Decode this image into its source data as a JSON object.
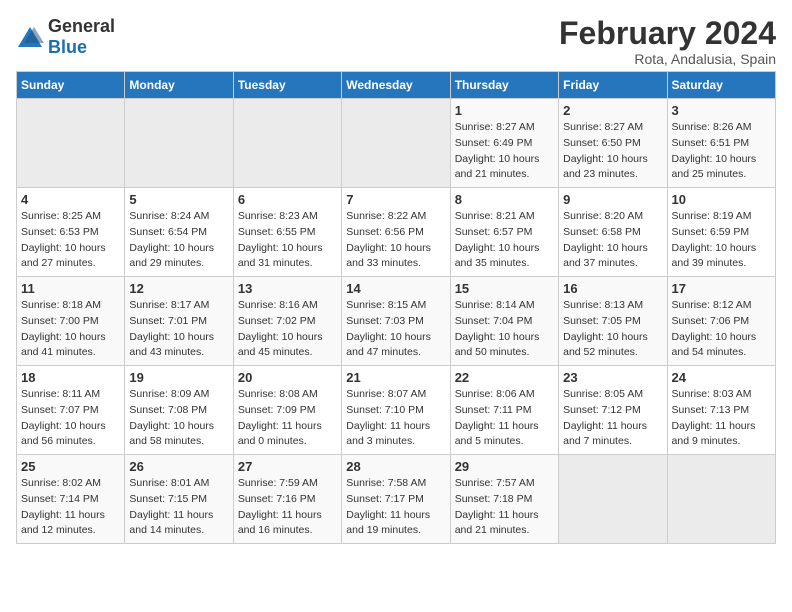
{
  "logo": {
    "general": "General",
    "blue": "Blue"
  },
  "title": "February 2024",
  "subtitle": "Rota, Andalusia, Spain",
  "days_of_week": [
    "Sunday",
    "Monday",
    "Tuesday",
    "Wednesday",
    "Thursday",
    "Friday",
    "Saturday"
  ],
  "weeks": [
    [
      {
        "day": "",
        "info": ""
      },
      {
        "day": "",
        "info": ""
      },
      {
        "day": "",
        "info": ""
      },
      {
        "day": "",
        "info": ""
      },
      {
        "day": "1",
        "info": "Sunrise: 8:27 AM\nSunset: 6:49 PM\nDaylight: 10 hours\nand 21 minutes."
      },
      {
        "day": "2",
        "info": "Sunrise: 8:27 AM\nSunset: 6:50 PM\nDaylight: 10 hours\nand 23 minutes."
      },
      {
        "day": "3",
        "info": "Sunrise: 8:26 AM\nSunset: 6:51 PM\nDaylight: 10 hours\nand 25 minutes."
      }
    ],
    [
      {
        "day": "4",
        "info": "Sunrise: 8:25 AM\nSunset: 6:53 PM\nDaylight: 10 hours\nand 27 minutes."
      },
      {
        "day": "5",
        "info": "Sunrise: 8:24 AM\nSunset: 6:54 PM\nDaylight: 10 hours\nand 29 minutes."
      },
      {
        "day": "6",
        "info": "Sunrise: 8:23 AM\nSunset: 6:55 PM\nDaylight: 10 hours\nand 31 minutes."
      },
      {
        "day": "7",
        "info": "Sunrise: 8:22 AM\nSunset: 6:56 PM\nDaylight: 10 hours\nand 33 minutes."
      },
      {
        "day": "8",
        "info": "Sunrise: 8:21 AM\nSunset: 6:57 PM\nDaylight: 10 hours\nand 35 minutes."
      },
      {
        "day": "9",
        "info": "Sunrise: 8:20 AM\nSunset: 6:58 PM\nDaylight: 10 hours\nand 37 minutes."
      },
      {
        "day": "10",
        "info": "Sunrise: 8:19 AM\nSunset: 6:59 PM\nDaylight: 10 hours\nand 39 minutes."
      }
    ],
    [
      {
        "day": "11",
        "info": "Sunrise: 8:18 AM\nSunset: 7:00 PM\nDaylight: 10 hours\nand 41 minutes."
      },
      {
        "day": "12",
        "info": "Sunrise: 8:17 AM\nSunset: 7:01 PM\nDaylight: 10 hours\nand 43 minutes."
      },
      {
        "day": "13",
        "info": "Sunrise: 8:16 AM\nSunset: 7:02 PM\nDaylight: 10 hours\nand 45 minutes."
      },
      {
        "day": "14",
        "info": "Sunrise: 8:15 AM\nSunset: 7:03 PM\nDaylight: 10 hours\nand 47 minutes."
      },
      {
        "day": "15",
        "info": "Sunrise: 8:14 AM\nSunset: 7:04 PM\nDaylight: 10 hours\nand 50 minutes."
      },
      {
        "day": "16",
        "info": "Sunrise: 8:13 AM\nSunset: 7:05 PM\nDaylight: 10 hours\nand 52 minutes."
      },
      {
        "day": "17",
        "info": "Sunrise: 8:12 AM\nSunset: 7:06 PM\nDaylight: 10 hours\nand 54 minutes."
      }
    ],
    [
      {
        "day": "18",
        "info": "Sunrise: 8:11 AM\nSunset: 7:07 PM\nDaylight: 10 hours\nand 56 minutes."
      },
      {
        "day": "19",
        "info": "Sunrise: 8:09 AM\nSunset: 7:08 PM\nDaylight: 10 hours\nand 58 minutes."
      },
      {
        "day": "20",
        "info": "Sunrise: 8:08 AM\nSunset: 7:09 PM\nDaylight: 11 hours\nand 0 minutes."
      },
      {
        "day": "21",
        "info": "Sunrise: 8:07 AM\nSunset: 7:10 PM\nDaylight: 11 hours\nand 3 minutes."
      },
      {
        "day": "22",
        "info": "Sunrise: 8:06 AM\nSunset: 7:11 PM\nDaylight: 11 hours\nand 5 minutes."
      },
      {
        "day": "23",
        "info": "Sunrise: 8:05 AM\nSunset: 7:12 PM\nDaylight: 11 hours\nand 7 minutes."
      },
      {
        "day": "24",
        "info": "Sunrise: 8:03 AM\nSunset: 7:13 PM\nDaylight: 11 hours\nand 9 minutes."
      }
    ],
    [
      {
        "day": "25",
        "info": "Sunrise: 8:02 AM\nSunset: 7:14 PM\nDaylight: 11 hours\nand 12 minutes."
      },
      {
        "day": "26",
        "info": "Sunrise: 8:01 AM\nSunset: 7:15 PM\nDaylight: 11 hours\nand 14 minutes."
      },
      {
        "day": "27",
        "info": "Sunrise: 7:59 AM\nSunset: 7:16 PM\nDaylight: 11 hours\nand 16 minutes."
      },
      {
        "day": "28",
        "info": "Sunrise: 7:58 AM\nSunset: 7:17 PM\nDaylight: 11 hours\nand 19 minutes."
      },
      {
        "day": "29",
        "info": "Sunrise: 7:57 AM\nSunset: 7:18 PM\nDaylight: 11 hours\nand 21 minutes."
      },
      {
        "day": "",
        "info": ""
      },
      {
        "day": "",
        "info": ""
      }
    ]
  ]
}
